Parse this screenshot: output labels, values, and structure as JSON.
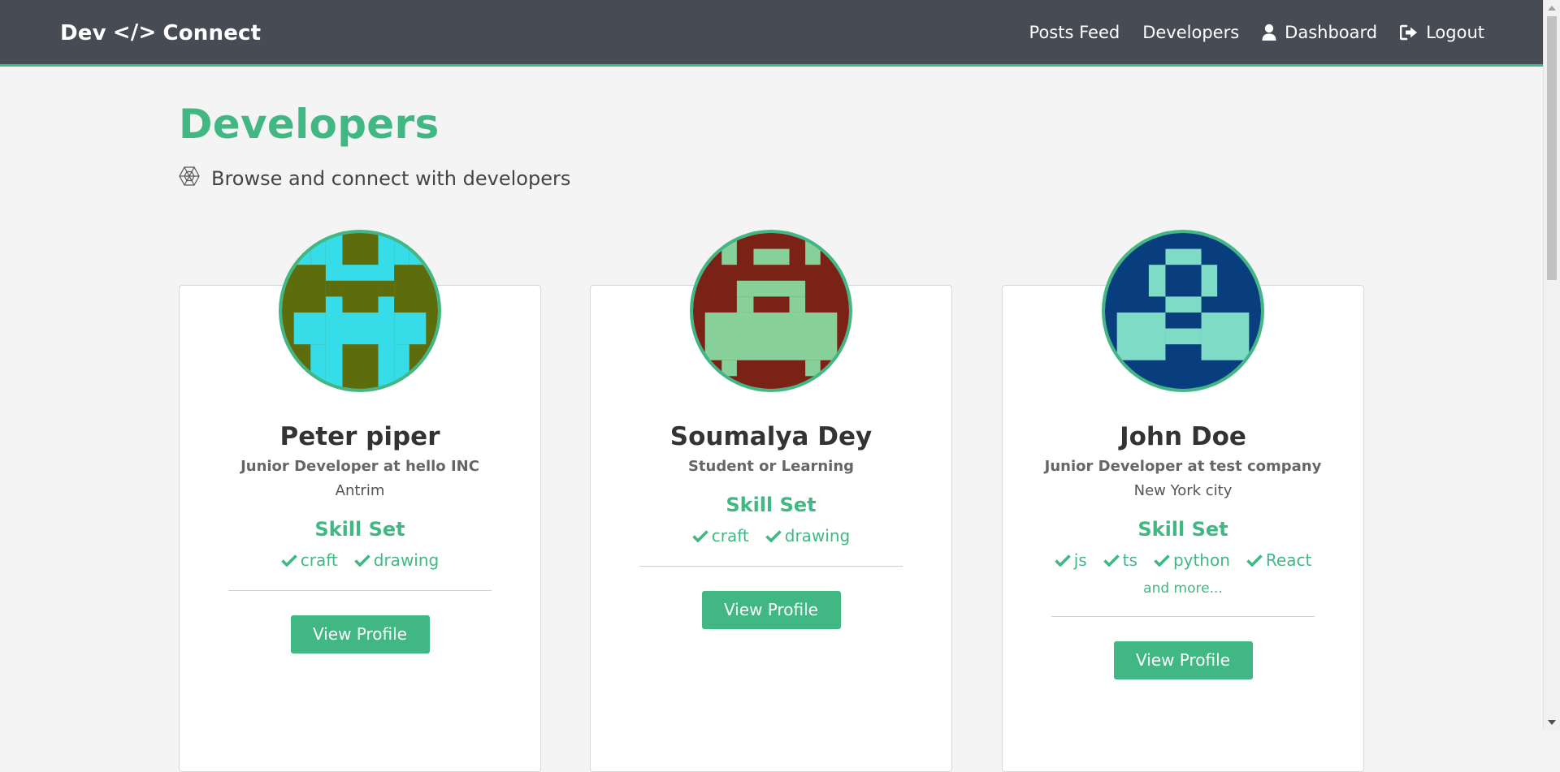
{
  "navbar": {
    "brand_left": "Dev",
    "brand_code": "</>",
    "brand_right": "Connect",
    "links": {
      "posts": "Posts Feed",
      "developers": "Developers",
      "dashboard": "Dashboard",
      "logout": "Logout"
    }
  },
  "header": {
    "title": "Developers",
    "subtitle": "Browse and connect with developers"
  },
  "developers": [
    {
      "name": "Peter piper",
      "status": "Junior Developer at hello INC",
      "location": "Antrim",
      "skills_heading": "Skill Set",
      "skills": [
        "craft",
        "drawing"
      ],
      "more": "",
      "button": "View Profile",
      "avatar_colors": {
        "bg": "#5d6c0c",
        "fg": "#36dde8"
      }
    },
    {
      "name": "Soumalya Dey",
      "status": "Student or Learning",
      "location": "",
      "skills_heading": "Skill Set",
      "skills": [
        "craft",
        "drawing"
      ],
      "more": "",
      "button": "View Profile",
      "avatar_colors": {
        "bg": "#7b2217",
        "fg": "#88d09a"
      }
    },
    {
      "name": "John Doe",
      "status": "Junior Developer at test company",
      "location": "New York city",
      "skills_heading": "Skill Set",
      "skills": [
        "js",
        "ts",
        "python",
        "React"
      ],
      "more": "and more...",
      "button": "View Profile",
      "avatar_colors": {
        "bg": "#083e7d",
        "fg": "#7ddbc6"
      }
    }
  ],
  "colors": {
    "accent": "#41b883",
    "navbar": "#474b53",
    "background": "#f4f4f4"
  }
}
